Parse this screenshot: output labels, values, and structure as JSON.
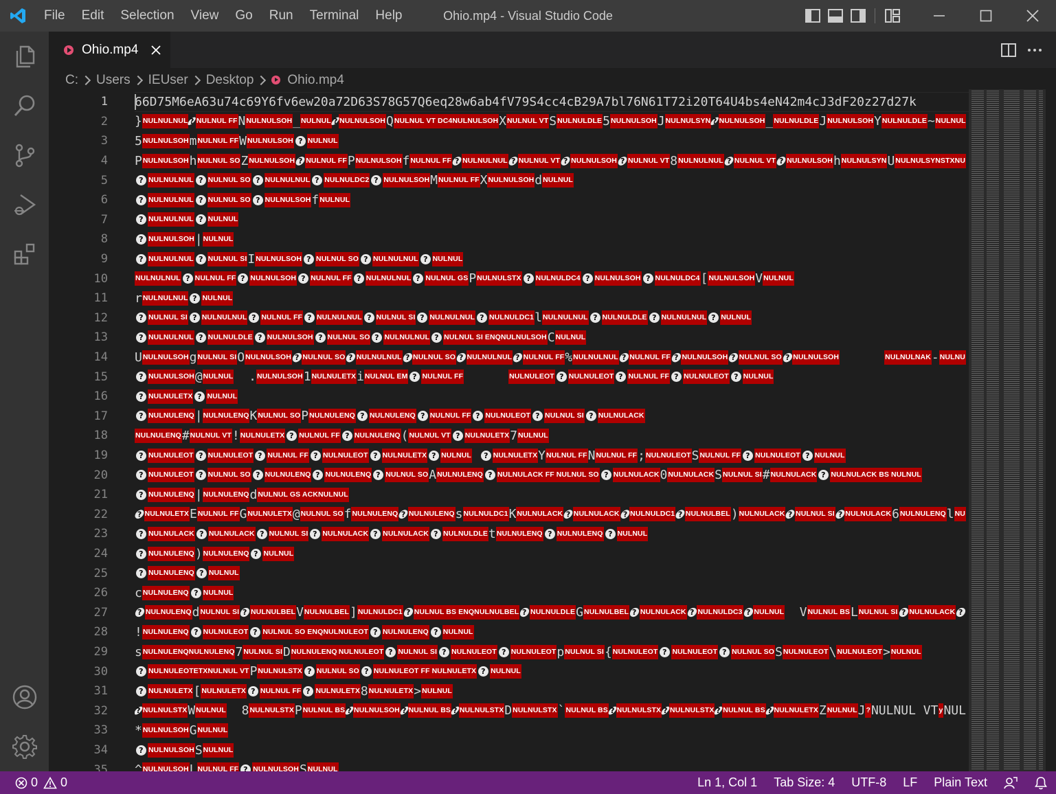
{
  "window": {
    "title": "Ohio.mp4 - Visual Studio Code",
    "menu": [
      "File",
      "Edit",
      "Selection",
      "View",
      "Go",
      "Run",
      "Terminal",
      "Help"
    ]
  },
  "activity_bar": {
    "items": [
      "explorer-icon",
      "search-icon",
      "source-control-icon",
      "run-debug-icon",
      "extensions-icon"
    ],
    "bottom": [
      "accounts-icon",
      "manage-gear-icon"
    ]
  },
  "tab": {
    "label": "Ohio.mp4"
  },
  "breadcrumb": [
    "C:",
    "Users",
    "IEUser",
    "Desktop",
    "Ohio.mp4"
  ],
  "editor": {
    "line1_text": "66D75M6eA63u74c69Y6fv6ew20a72D63S78G57Q6eq28w6ab4fV79S4cc4cB29A7bl76N61T72i20T64U4bs4eN42m4cJ3dF20z27d27k",
    "lines": [
      "1",
      "2",
      "3",
      "4",
      "5",
      "6",
      "7",
      "8",
      "9",
      "10",
      "11",
      "12",
      "13",
      "14",
      "15",
      "16",
      "17",
      "18",
      "19",
      "20",
      "21",
      "22",
      "23",
      "24",
      "25",
      "26",
      "27",
      "28",
      "29",
      "30",
      "31",
      "32",
      "33",
      "34",
      "35"
    ],
    "rows": [
      [
        "}",
        "NULNULNUL",
        "?",
        "NULNUL FF",
        "N",
        "NULNULSOH",
        "_",
        "NULNUL",
        "?",
        "NULNULSOH",
        "Q",
        "NULNUL VT DC4NULNULSOH",
        "X",
        "NULNUL VT",
        "S",
        "NULNULDLE",
        "5",
        "NULNULSOH",
        "J",
        "NULNULSYN",
        "?",
        "NULNULSOH",
        "_",
        "NULNULDLE",
        "J",
        "NULNULSOH",
        "Y",
        "NULNULDLE",
        "~",
        "NULNULNU"
      ],
      [
        "5",
        "NULNULSOH",
        "m",
        "NULNUL FF",
        "W",
        "NULNULSOH",
        "?",
        "NULNUL"
      ],
      [
        "P",
        "NULNULSOH",
        "h",
        "NULNUL SO",
        "Z",
        "NULNULSOH",
        "?",
        "NULNUL FF",
        "P",
        "NULNULSOH",
        "f",
        "NULNUL FF",
        "?",
        "NULNULNUL",
        "?",
        "NULNUL VT",
        "?",
        "NULNULSOH",
        "?",
        "NULNUL VT",
        "8",
        "NULNULNUL",
        "?",
        "NULNUL VT",
        "?",
        "NULNULSOH",
        "h",
        "NULNULSYN",
        "U",
        "NULNULSYNSTXNU"
      ],
      [
        "?",
        "NULNULNUL",
        "?",
        "NULNUL SO",
        "?",
        "NULNULNUL",
        "?",
        "NULNULDC2",
        "?",
        "NULNULSOH",
        "M",
        "NULNUL FF",
        "X",
        "NULNULSOH",
        "d",
        "NULNUL"
      ],
      [
        "?",
        "NULNULNUL",
        "?",
        "NULNUL SO",
        "?",
        "NULNULSOH",
        "f",
        "NULNUL"
      ],
      [
        "?",
        "NULNULNUL",
        "?",
        "NULNUL"
      ],
      [
        "?",
        "NULNULSOH",
        "|",
        "NULNUL"
      ],
      [
        "?",
        "NULNULNUL",
        "?",
        "NULNUL SI",
        "I",
        "NULNULSOH",
        "?",
        "NULNUL SO",
        "?",
        "NULNULNUL",
        "?",
        "NULNUL"
      ],
      [
        "",
        "NULNULNUL",
        "?",
        "NULNUL FF",
        "?",
        "NULNULSOH",
        "?",
        "NULNUL FF",
        "?",
        "NULNULNUL",
        "?",
        "NULNUL GS",
        "P",
        "NULNULSTX",
        "?",
        "NULNULDC4",
        "?",
        "NULNULSOH",
        "?",
        "NULNULDC4",
        "[",
        "NULNULSOH",
        "V",
        "NULNUL"
      ],
      [
        "r",
        "NULNULNUL",
        "?",
        "NULNUL"
      ],
      [
        "?",
        "NULNUL SI",
        "?",
        "NULNULNUL",
        "?",
        "NULNUL FF",
        "?",
        "NULNULNUL",
        "?",
        "NULNUL SI",
        "?",
        "NULNULNUL",
        "?",
        "NULNULDC1",
        "l",
        "NULNULNUL",
        "?",
        "NULNULDLE",
        "?",
        "NULNULNUL",
        "?",
        "NULNUL"
      ],
      [
        "?",
        "NULNULNUL",
        "?",
        "NULNULDLE",
        "?",
        "NULNULSOH",
        "?",
        "NULNUL SO",
        "?",
        "NULNULNUL",
        "?",
        "NULNUL SI ENQNULNULSOH",
        "C",
        "NULNUL"
      ],
      [
        "U",
        "NULNULSOH",
        "g",
        "NULNUL SI",
        "O",
        "NULNULSOH",
        "?",
        "NULNUL SO",
        "?",
        "NULNULNUL",
        "?",
        "NULNUL SO",
        "?",
        "NULNULNUL",
        "?",
        "NULNUL FF",
        "%",
        "NULNULNUL",
        "?",
        "NULNUL FF",
        "?",
        "NULNULSOH",
        "?",
        "NULNUL SO",
        "?",
        "NULNULSOH",
        "      ",
        "NULNULNAK",
        "-",
        "NULNU"
      ],
      [
        "?",
        "NULNULSOH",
        "@",
        "NULNUL",
        "  .",
        "NULNULSOH",
        "1",
        "NULNULETX",
        "i",
        "NULNUL EM",
        "?",
        "NULNUL FF",
        "      ",
        "NULNULEOT",
        "?",
        "NULNULEOT",
        "?",
        "NULNUL FF",
        "?",
        "NULNULEOT",
        "?",
        "NULNUL"
      ],
      [
        "?",
        "NULNULETX",
        "?",
        "NULNUL"
      ],
      [
        "?",
        "NULNULENQ",
        "|",
        "NULNULENQ",
        "K",
        "NULNUL SO",
        "P",
        "NULNULENQ",
        "?",
        "NULNULENQ",
        "?",
        "NULNUL FF",
        "?",
        "NULNULEOT",
        "?",
        "NULNUL SI",
        "?",
        "NULNULACK"
      ],
      [
        "",
        "NULNULENQ",
        "#",
        "NULNUL VT",
        "!",
        "NULNULETX",
        "?",
        "NULNUL FF",
        "?",
        "NULNULENQ",
        "(",
        "NULNUL VT",
        "?",
        "NULNULETX",
        "7",
        "NULNUL"
      ],
      [
        "?",
        "NULNULEOT",
        "?",
        "NULNULEOT",
        "?",
        "NULNUL FF",
        "?",
        "NULNULEOT",
        "?",
        "NULNULETX",
        "?",
        "NULNUL",
        "  ?",
        "NULNULETX",
        "Y",
        "NULNUL FF",
        "N",
        "NULNUL FF",
        ";",
        "NULNULEOT",
        "S",
        "NULNUL FF",
        "?",
        "NULNULEOT",
        "?",
        "NULNUL"
      ],
      [
        "?",
        "NULNULEOT",
        "?",
        "NULNUL SO",
        "?",
        "NULNULENQ",
        "?",
        "NULNULENQ",
        "?",
        "NULNUL SO",
        "A",
        "NULNULENQ",
        "?",
        "NULNULACK FF NULNUL SO",
        "?",
        "NULNULACK",
        "0",
        "NULNULACK",
        "S",
        "NULNUL SI",
        "#",
        "NULNULACK",
        "?",
        "NULNULACK BS NULNUL"
      ],
      [
        "?",
        "NULNULENQ",
        "|",
        "NULNULENQ",
        "d",
        "NULNUL GS ACKNULNUL"
      ],
      [
        "?",
        "NULNULETX",
        "E",
        "NULNUL FF",
        "G",
        "NULNULETX",
        "@",
        "NULNUL SO",
        "f",
        "NULNULENQ",
        "?",
        "NULNULENQ",
        "s",
        "NULNULDC1",
        "K",
        "NULNULACK",
        "?",
        "NULNULACK",
        "?",
        "NULNULDC1",
        "?",
        "NULNULBEL",
        ")",
        "NULNULACK",
        "?",
        "NULNUL SI",
        "?",
        "NULNULACK",
        "6",
        "NULNULENQ",
        "l",
        "NU"
      ],
      [
        "?",
        "NULNULACK",
        "?",
        "NULNULACK",
        "?",
        "NULNUL SI",
        "?",
        "NULNULACK",
        "?",
        "NULNULACK",
        "?",
        "NULNULDLE",
        "t",
        "NULNULENQ",
        "?",
        "NULNULENQ",
        "?",
        "NULNUL"
      ],
      [
        "?",
        "NULNULENQ",
        ")",
        "NULNULENQ",
        "?",
        "NULNUL"
      ],
      [
        "?",
        "NULNULENQ",
        "?",
        "NULNUL"
      ],
      [
        "c",
        "NULNULENQ",
        "?",
        "NULNUL"
      ],
      [
        "?",
        "NULNULENQ",
        "d",
        "NULNUL SI",
        "?",
        "NULNULBEL",
        "V",
        "NULNULBEL",
        "]",
        "NULNULDC1",
        "?",
        "NULNUL BS ENQNULNULBEL",
        "?",
        "NULNULDLE",
        "G",
        "NULNULBEL",
        "?",
        "NULNULACK",
        "?",
        "NULNULDC3",
        "?",
        "NULNUL",
        "  V",
        "NULNUL BS",
        "L",
        "NULNUL SI",
        "?",
        "NULNULACK",
        "?",
        ""
      ],
      [
        "!",
        "NULNULENQ",
        "?",
        "NULNULEOT",
        "?",
        "NULNUL SO ENQNULNULEOT",
        "?",
        "NULNULENQ",
        "?",
        "NULNUL"
      ],
      [
        "s",
        "NULNULENQNULNULENQ",
        "7",
        "NULNUL SI",
        "D",
        "NULNULENQ",
        "",
        "NULNULEOT",
        "?",
        "NULNUL SI",
        "?",
        "NULNULEOT",
        "?",
        "NULNULEOT",
        "p",
        "NULNUL SI",
        "{",
        "NULNULEOT",
        "?",
        "NULNULEOT",
        "?",
        "NULNUL SO",
        "S",
        "NULNULEOT",
        "\\",
        "NULNULEOT",
        ">",
        "NULNUL"
      ],
      [
        "?",
        "NULNULEOTETXNULNUL VT",
        "P",
        "NULNULSTX",
        "?",
        "NULNUL SO",
        "?",
        "NULNULEOT FF NULNULETX",
        "?",
        "NULNUL"
      ],
      [
        "?",
        "NULNULETX",
        "[",
        "NULNULETX",
        "?",
        "NULNUL FF",
        "?",
        "NULNULETX",
        "8",
        "NULNULETX",
        ">",
        "NULNUL"
      ],
      [
        "?",
        "NULNULSTX",
        "W",
        "NULNUL",
        "  8",
        "NULNULSTX",
        "P",
        "NULNUL BS",
        "?",
        "NULNULSOH",
        "?",
        "NULNUL BS",
        "?",
        "NULNULSTX",
        "D",
        "NULNULSTX",
        "`",
        "NULNUL BS",
        "?",
        "NULNULSTX",
        "?",
        "NULNULSTX",
        "?",
        "NULNUL BS",
        "?",
        "NULNULETX",
        "Z",
        "NULNUL",
        "J",
        "?",
        "NULNUL VT",
        "y",
        "NUL"
      ],
      [
        "*",
        "NULNULSOH",
        "G",
        "NULNUL"
      ],
      [
        "?",
        "NULNULSOH",
        "S",
        "NULNUL"
      ],
      [
        "^",
        "NULNULSOH",
        "L",
        "NULNUL FF",
        "?",
        "NULNULSOH",
        "S",
        "NULNUL"
      ]
    ]
  },
  "status_bar": {
    "errors": "0",
    "warnings": "0",
    "position": "Ln 1, Col 1",
    "tab_size": "Tab Size: 4",
    "encoding": "UTF-8",
    "eol": "LF",
    "language": "Plain Text"
  },
  "colors": {
    "titlebar": "#3c3c3c",
    "activitybar": "#333333",
    "editor": "#1e1e1e",
    "statusbar": "#68217a",
    "control_char": "#b00000",
    "file_icon": "#e24e73"
  }
}
